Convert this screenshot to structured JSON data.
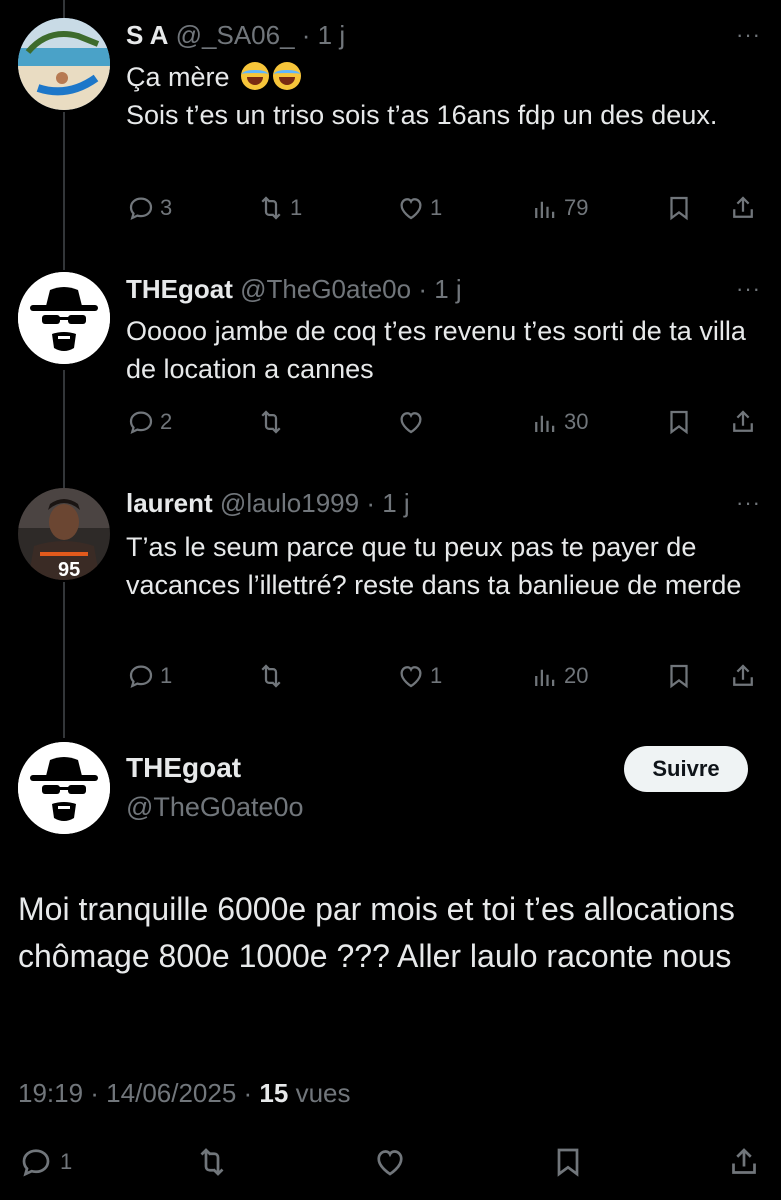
{
  "thread": [
    {
      "name": "S A",
      "handle": "@_SA06_",
      "time": "· 1 j",
      "more": "···",
      "lines": [
        "Ça mère",
        "Sois t’es un triso sois t’as 16ans fdp un des deux."
      ],
      "emoji": [
        "face-with-tears-of-joy",
        "face-with-tears-of-joy"
      ],
      "counts": {
        "replies": "3",
        "retweets": "1",
        "likes": "1",
        "views": "79"
      }
    },
    {
      "name": "THEgoat",
      "handle": "@TheG0ate0o",
      "time": "· 1 j",
      "more": "···",
      "lines": [
        "Ooooo jambe de coq t’es revenu t’es sorti de ta villa de location a cannes"
      ],
      "counts": {
        "replies": "2",
        "retweets": "",
        "likes": "",
        "views": "30"
      }
    },
    {
      "name": "laurent",
      "handle": "@laulo1999",
      "time": "· 1 j",
      "more": "···",
      "lines": [
        "T’as le seum parce que tu peux pas te payer de vacances l’illettré? reste dans ta banlieue de merde"
      ],
      "counts": {
        "replies": "1",
        "retweets": "",
        "likes": "1",
        "views": "20"
      }
    }
  ],
  "main": {
    "name": "THEgoat",
    "handle": "@TheG0ate0o",
    "follow_label": "Suivre",
    "text": "Moi tranquille 6000e par mois et toi t’es allocations chômage 800e 1000e ??? Aller laulo raconte nous",
    "time": "19:19 · 14/06/2025 ·",
    "views_count": "15",
    "views_label": "vues",
    "counts": {
      "replies": "1"
    }
  },
  "colors": {
    "background": "#000000",
    "text": "#e7e9ea",
    "muted": "#71767b",
    "follow_bg": "#eff3f4"
  }
}
